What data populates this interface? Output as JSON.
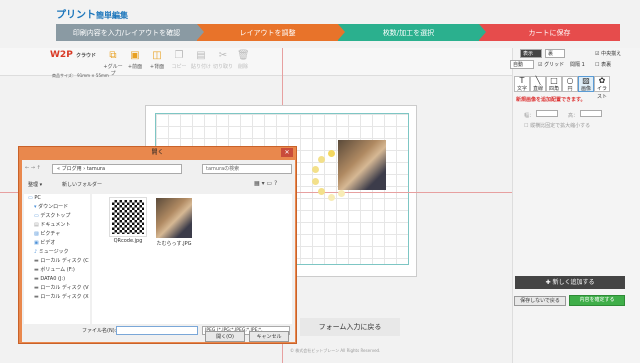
{
  "brand": {
    "logo_text": "プリント",
    "subtitle": "簡単編集"
  },
  "steps": [
    {
      "label": "印刷内容を入力/レイアウトを確認",
      "color": "#8a9aa3"
    },
    {
      "label": "レイアウトを調整",
      "color": "#e8732a"
    },
    {
      "label": "枚数/加工を選択",
      "color": "#2bb08e"
    },
    {
      "label": "カートに保存",
      "color": "#e64c4c"
    }
  ],
  "toolbar": {
    "logo": "W2P",
    "logo_sub": "クラウド",
    "tools": [
      {
        "label": "+グループ",
        "icon": "group-icon",
        "disabled": false
      },
      {
        "label": "+前面",
        "icon": "bring-front-icon",
        "disabled": false
      },
      {
        "label": "+背面",
        "icon": "send-back-icon",
        "disabled": false
      },
      {
        "label": "コピー",
        "icon": "copy-icon",
        "disabled": true
      },
      {
        "label": "貼り付け",
        "icon": "paste-icon",
        "disabled": true
      },
      {
        "label": "切り取り",
        "icon": "cut-icon",
        "disabled": true
      },
      {
        "label": "削除",
        "icon": "trash-icon",
        "disabled": true
      }
    ],
    "size_info": "商品サイズ： 91mm × 55mm"
  },
  "right_panel": {
    "display_label": "表示",
    "zoom_value": "自動",
    "page_label": "裏",
    "grid_label": "グリッド",
    "interval_label": "間隔",
    "interval_value": "1",
    "guide_label": "表裏",
    "snap_label": "中央揃え",
    "tools": [
      {
        "label": "文字",
        "icon": "text-tool-icon"
      },
      {
        "label": "直線",
        "icon": "line-tool-icon"
      },
      {
        "label": "四角",
        "icon": "rect-tool-icon"
      },
      {
        "label": "円",
        "icon": "circle-tool-icon"
      },
      {
        "label": "画像",
        "icon": "image-tool-icon"
      },
      {
        "label": "イラスト",
        "icon": "illust-tool-icon"
      }
    ],
    "notice": "新規画像を追加配置できます。",
    "field1_label": "幅：",
    "field2_label": "高：",
    "checkbox_label": "縦横比固定で拡大縮小する",
    "add_button": "新しく追加する",
    "save_button": "保存しないで戻る",
    "confirm_button": "内容を確定する"
  },
  "dialog": {
    "title": "開く",
    "address": "« ブログ用 › tamura",
    "search_placeholder": "tamuraの検索",
    "organize": "整理 ▾",
    "new_folder": "新しいフォルダー",
    "tree": [
      "PC",
      "ダウンロード",
      "デスクトップ",
      "ドキュメント",
      "ピクチャ",
      "ビデオ",
      "ミュージック",
      "ローカル ディスク (C",
      "ボリューム (F:)",
      "DATA0 (J:)",
      "ローカル ディスク (V",
      "ローカル ディスク (X"
    ],
    "files": [
      {
        "name": "QRcode.jpg",
        "type": "qr"
      },
      {
        "name": "たむらっす.JPG",
        "type": "photo"
      }
    ],
    "filename_label": "ファイル名(N):",
    "filetype": "JPEG (*.JPG;*.JPEG;*.JPE;*.",
    "open_button": "開く(O)",
    "cancel_button": "キャンセル"
  },
  "back_button": "フォーム入力に戻る",
  "footer": "© 株式会社ビットブレーン All Rights Reserved."
}
